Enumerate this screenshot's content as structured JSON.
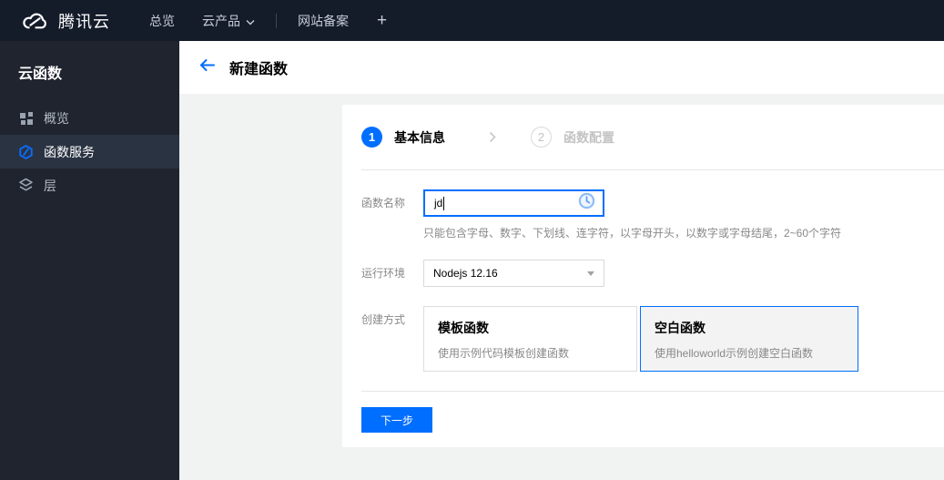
{
  "topbar": {
    "brand": "腾讯云",
    "items": [
      {
        "label": "总览"
      },
      {
        "label": "云产品"
      },
      {
        "label": "网站备案"
      }
    ],
    "plus_label": "+"
  },
  "sidebar": {
    "title": "云函数",
    "items": [
      {
        "label": "概览",
        "icon": "grid-icon",
        "active": false
      },
      {
        "label": "函数服务",
        "icon": "scf-hexagon-icon",
        "active": true
      },
      {
        "label": "层",
        "icon": "layers-icon",
        "active": false
      }
    ]
  },
  "header": {
    "title": "新建函数"
  },
  "wizard": {
    "steps": [
      {
        "num": "1",
        "label": "基本信息",
        "active": true
      },
      {
        "num": "2",
        "label": "函数配置",
        "active": false
      }
    ]
  },
  "form": {
    "name": {
      "label": "函数名称",
      "value": "jd",
      "hint": "只能包含字母、数字、下划线、连字符，以字母开头，以数字或字母结尾，2~60个字符",
      "status_icon": "clock-pending-icon"
    },
    "runtime": {
      "label": "运行环境",
      "value": "Nodejs 12.16"
    },
    "method": {
      "label": "创建方式",
      "options": [
        {
          "title": "模板函数",
          "desc": "使用示例代码模板创建函数",
          "selected": false
        },
        {
          "title": "空白函数",
          "desc": "使用helloworld示例创建空白函数",
          "selected": true
        }
      ]
    }
  },
  "footer": {
    "next_label": "下一步"
  },
  "colors": {
    "accent": "#006eff",
    "topbar_bg": "#141b29",
    "sidebar_bg": "#1f242e",
    "sidebar_active_bg": "#2a3342",
    "content_bg": "#f1f2f2",
    "selected_card_bg": "#f3f3f3"
  }
}
